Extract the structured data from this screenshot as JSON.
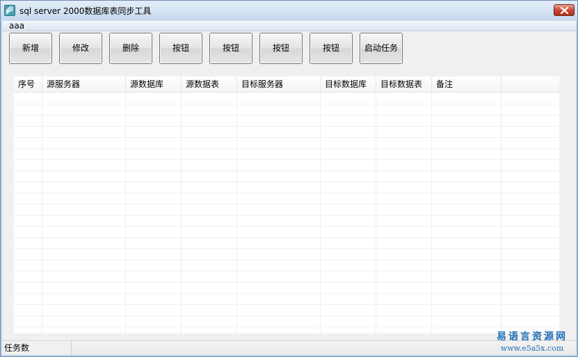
{
  "window": {
    "title": "sql server 2000数据库表同步工具"
  },
  "menu": {
    "items": [
      "aaa"
    ]
  },
  "toolbar": {
    "buttons": [
      "新增",
      "修改",
      "删除",
      "按钮",
      "按钮",
      "按钮",
      "按钮",
      "启动任务"
    ]
  },
  "table": {
    "columns": [
      "序号",
      "源服务器",
      "源数据库",
      "源数据表",
      "目标服务器",
      "目标数据库",
      "目标数据表",
      "备注"
    ],
    "rows": []
  },
  "statusbar": {
    "label": "任务数"
  },
  "watermark": {
    "line1": "易语言资源网",
    "line2": "www.e5a5x.com"
  },
  "colors": {
    "title_bar": "#c6d9ee",
    "close_button": "#c7422a",
    "watermark": "#1f6fb5"
  },
  "icons": [
    "app-logo-icon",
    "close-icon"
  ]
}
